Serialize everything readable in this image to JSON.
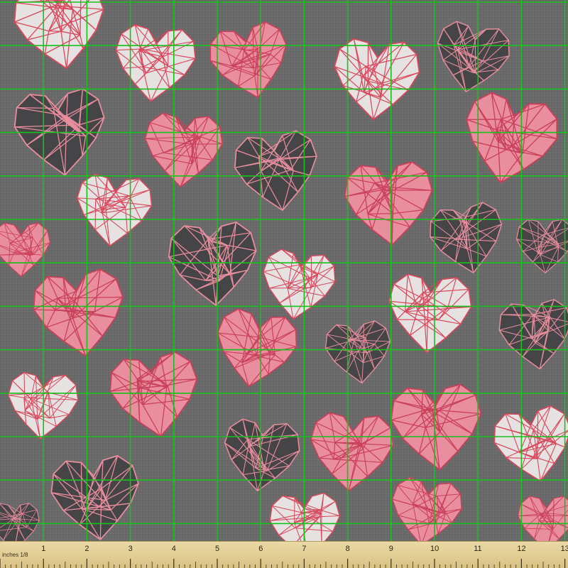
{
  "colors": {
    "background": "#6b6b6b",
    "heart_white": "#e6e2e2",
    "heart_pink": "#e98e9e",
    "heart_dark": "#454446",
    "line_on_light": "#d9485c",
    "line_on_dark": "#e98e9e",
    "grid": "#16c21c",
    "ruler": "#e3cf95"
  },
  "ruler": {
    "unit_label": "inches 1/8",
    "numbers": [
      "1",
      "2",
      "3",
      "4",
      "5",
      "6",
      "7",
      "8",
      "9",
      "10",
      "11",
      "12",
      "13"
    ]
  },
  "pattern": {
    "motif": "low-poly geometric hearts",
    "hearts": [
      {
        "kind": "white"
      },
      {
        "kind": "white"
      },
      {
        "kind": "pink"
      },
      {
        "kind": "white"
      },
      {
        "kind": "dark"
      },
      {
        "kind": "dark"
      },
      {
        "kind": "pink"
      },
      {
        "kind": "dark"
      },
      {
        "kind": "pink"
      },
      {
        "kind": "pink"
      },
      {
        "kind": "white"
      },
      {
        "kind": "dark"
      },
      {
        "kind": "pink"
      },
      {
        "kind": "dark"
      },
      {
        "kind": "dark"
      },
      {
        "kind": "white"
      },
      {
        "kind": "pink"
      },
      {
        "kind": "white"
      },
      {
        "kind": "dark"
      },
      {
        "kind": "pink"
      },
      {
        "kind": "dark"
      },
      {
        "kind": "pink"
      },
      {
        "kind": "white"
      },
      {
        "kind": "pink"
      },
      {
        "kind": "pink"
      },
      {
        "kind": "white"
      },
      {
        "kind": "dark"
      },
      {
        "kind": "dark"
      },
      {
        "kind": "pink"
      },
      {
        "kind": "white"
      },
      {
        "kind": "dark"
      },
      {
        "kind": "pink"
      }
    ]
  }
}
